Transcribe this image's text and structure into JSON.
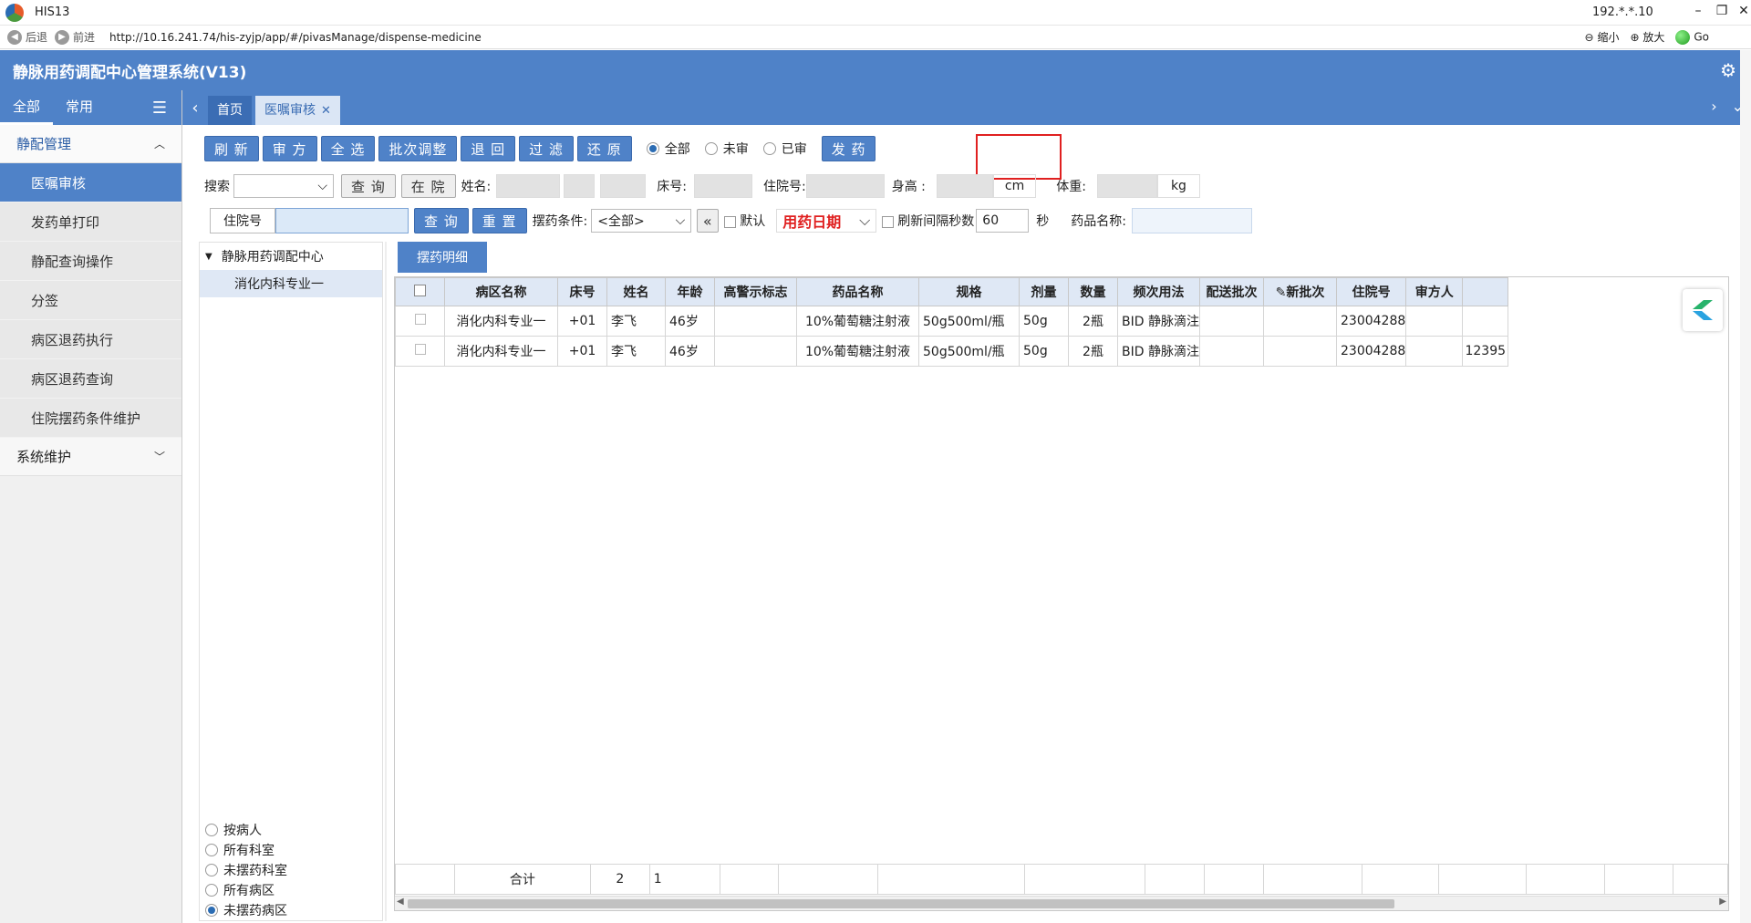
{
  "browser": {
    "title": "HIS13",
    "ip": "192.*.*.10",
    "back": "后退",
    "forward": "前进",
    "url": "http://10.16.241.74/his-zyjp/app/#/pivasManage/dispense-medicine",
    "zoom_out": "缩小",
    "zoom_in": "放大",
    "go": "Go"
  },
  "app": {
    "title": "静脉用药调配中心管理系统(V13)"
  },
  "sidebar": {
    "tab_all": "全部",
    "tab_common": "常用",
    "group1": "静配管理",
    "items": [
      "医嘱审核",
      "发药单打印",
      "静配查询操作",
      "分签",
      "病区退药执行",
      "病区退药查询",
      "住院摆药条件维护"
    ],
    "group2": "系统维护"
  },
  "tabs": {
    "home": "首页",
    "current": "医嘱审核"
  },
  "toolbar": {
    "refresh": "刷 新",
    "review": "审 方",
    "select_all": "全 选",
    "batch_adjust": "批次调整",
    "return": "退 回",
    "filter": "过 滤",
    "restore": "还 原",
    "radio_all": "全部",
    "radio_unreviewed": "未审",
    "radio_reviewed": "已审",
    "dispense": "发 药"
  },
  "row2": {
    "search_label": "搜索",
    "query": "查 询",
    "in_hospital": "在 院",
    "name_label": "姓名:",
    "bed_label": "床号:",
    "admission_label": "住院号:",
    "height_label": "身高 :",
    "height_unit": "cm",
    "weight_label": "体重:",
    "weight_unit": "kg"
  },
  "row3": {
    "admission_label": "住院号",
    "query": "查 询",
    "reset": "重 置",
    "condition_label": "摆药条件:",
    "condition_value": "<全部>",
    "collapse": "«",
    "default_label": "默认",
    "date_label": "用药日期",
    "refresh_interval_label": "刷新间隔秒数",
    "refresh_interval_value": "60",
    "seconds": "秒",
    "drug_name_label": "药品名称:"
  },
  "tree": {
    "root": "静脉用药调配中心",
    "leaf": "消化内科专业一",
    "options": [
      "按病人",
      "所有科室",
      "未摆药科室",
      "所有病区",
      "未摆药病区"
    ]
  },
  "grid": {
    "tab": "摆药明细",
    "columns": [
      "病区名称",
      "床号",
      "姓名",
      "年龄",
      "高警示标志",
      "药品名称",
      "规格",
      "剂量",
      "数量",
      "频次用法",
      "配送批次",
      "新批次",
      "住院号",
      "审方人",
      ""
    ],
    "rows": [
      [
        "消化内科专业一",
        "+01",
        "李飞",
        "46岁",
        "",
        "10%葡萄糖注射液",
        "50g500ml/瓶",
        "50g",
        "2瓶",
        "BID 静脉滴注",
        "",
        "",
        "23004288",
        "",
        ""
      ],
      [
        "消化内科专业一",
        "+01",
        "李飞",
        "46岁",
        "",
        "10%葡萄糖注射液",
        "50g500ml/瓶",
        "50g",
        "2瓶",
        "BID 静脉滴注",
        "",
        "",
        "23004288",
        "",
        "12395"
      ]
    ],
    "footer_label": "合计",
    "footer_bed": "2",
    "footer_name": "1"
  }
}
